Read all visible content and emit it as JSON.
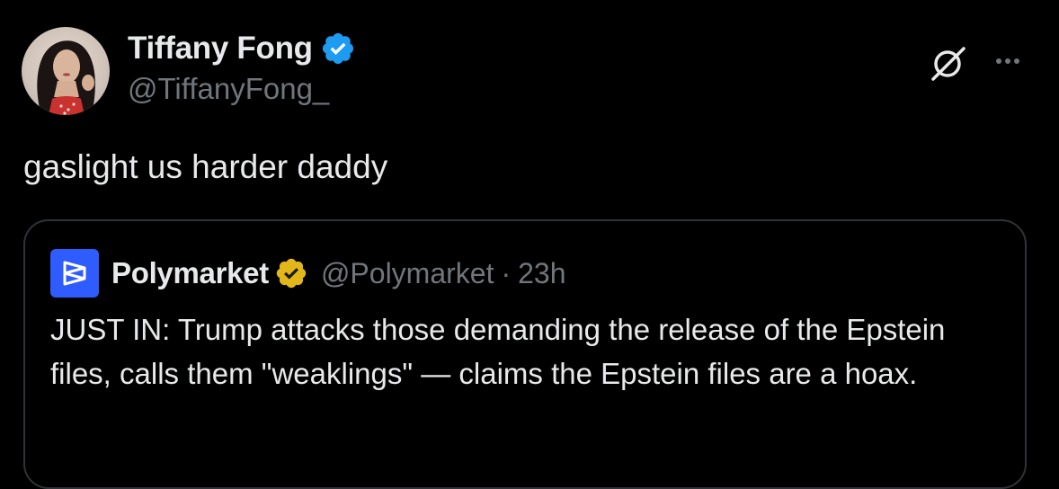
{
  "tweet": {
    "author": {
      "display_name": "Tiffany Fong",
      "handle": "@TiffanyFong_",
      "verified_badge_color": "#1d9bf0"
    },
    "text": "gaslight us harder daddy",
    "actions": {
      "grok_icon": "grok-icon",
      "more_icon": "more-horizontal-icon"
    }
  },
  "quoted_tweet": {
    "author": {
      "display_name": "Polymarket",
      "handle": "@Polymarket",
      "separator": "·",
      "time": "23h",
      "avatar_color": "#2e5cff",
      "verified_badge_color": "#e2b719"
    },
    "text": "JUST IN: Trump attacks those demanding the release of the Epstein files, calls them \"weaklings\" — claims the Epstein files are a hoax."
  },
  "colors": {
    "background": "#000000",
    "primary_text": "#e7e9ea",
    "secondary_text": "#71767b",
    "border": "#2f3336"
  }
}
